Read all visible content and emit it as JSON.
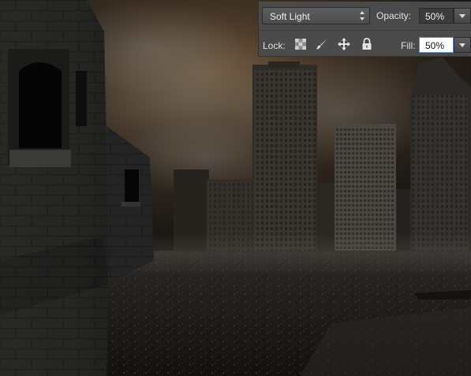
{
  "layers_panel": {
    "blend_mode": {
      "selected": "Soft Light"
    },
    "opacity": {
      "label": "Opacity:",
      "value": "50%"
    },
    "lock": {
      "label": "Lock:",
      "icons": [
        "transparency-lock-icon",
        "brush-lock-icon",
        "move-lock-icon",
        "padlock-icon"
      ]
    },
    "fill": {
      "label": "Fill:",
      "value": "50%"
    }
  },
  "colors": {
    "panel_bg": "#4a4a4a",
    "field_dark": "#3c3c3c",
    "field_active": "#ffffff",
    "sky_glow": "#6a5236",
    "ground": "#1c1a17"
  }
}
